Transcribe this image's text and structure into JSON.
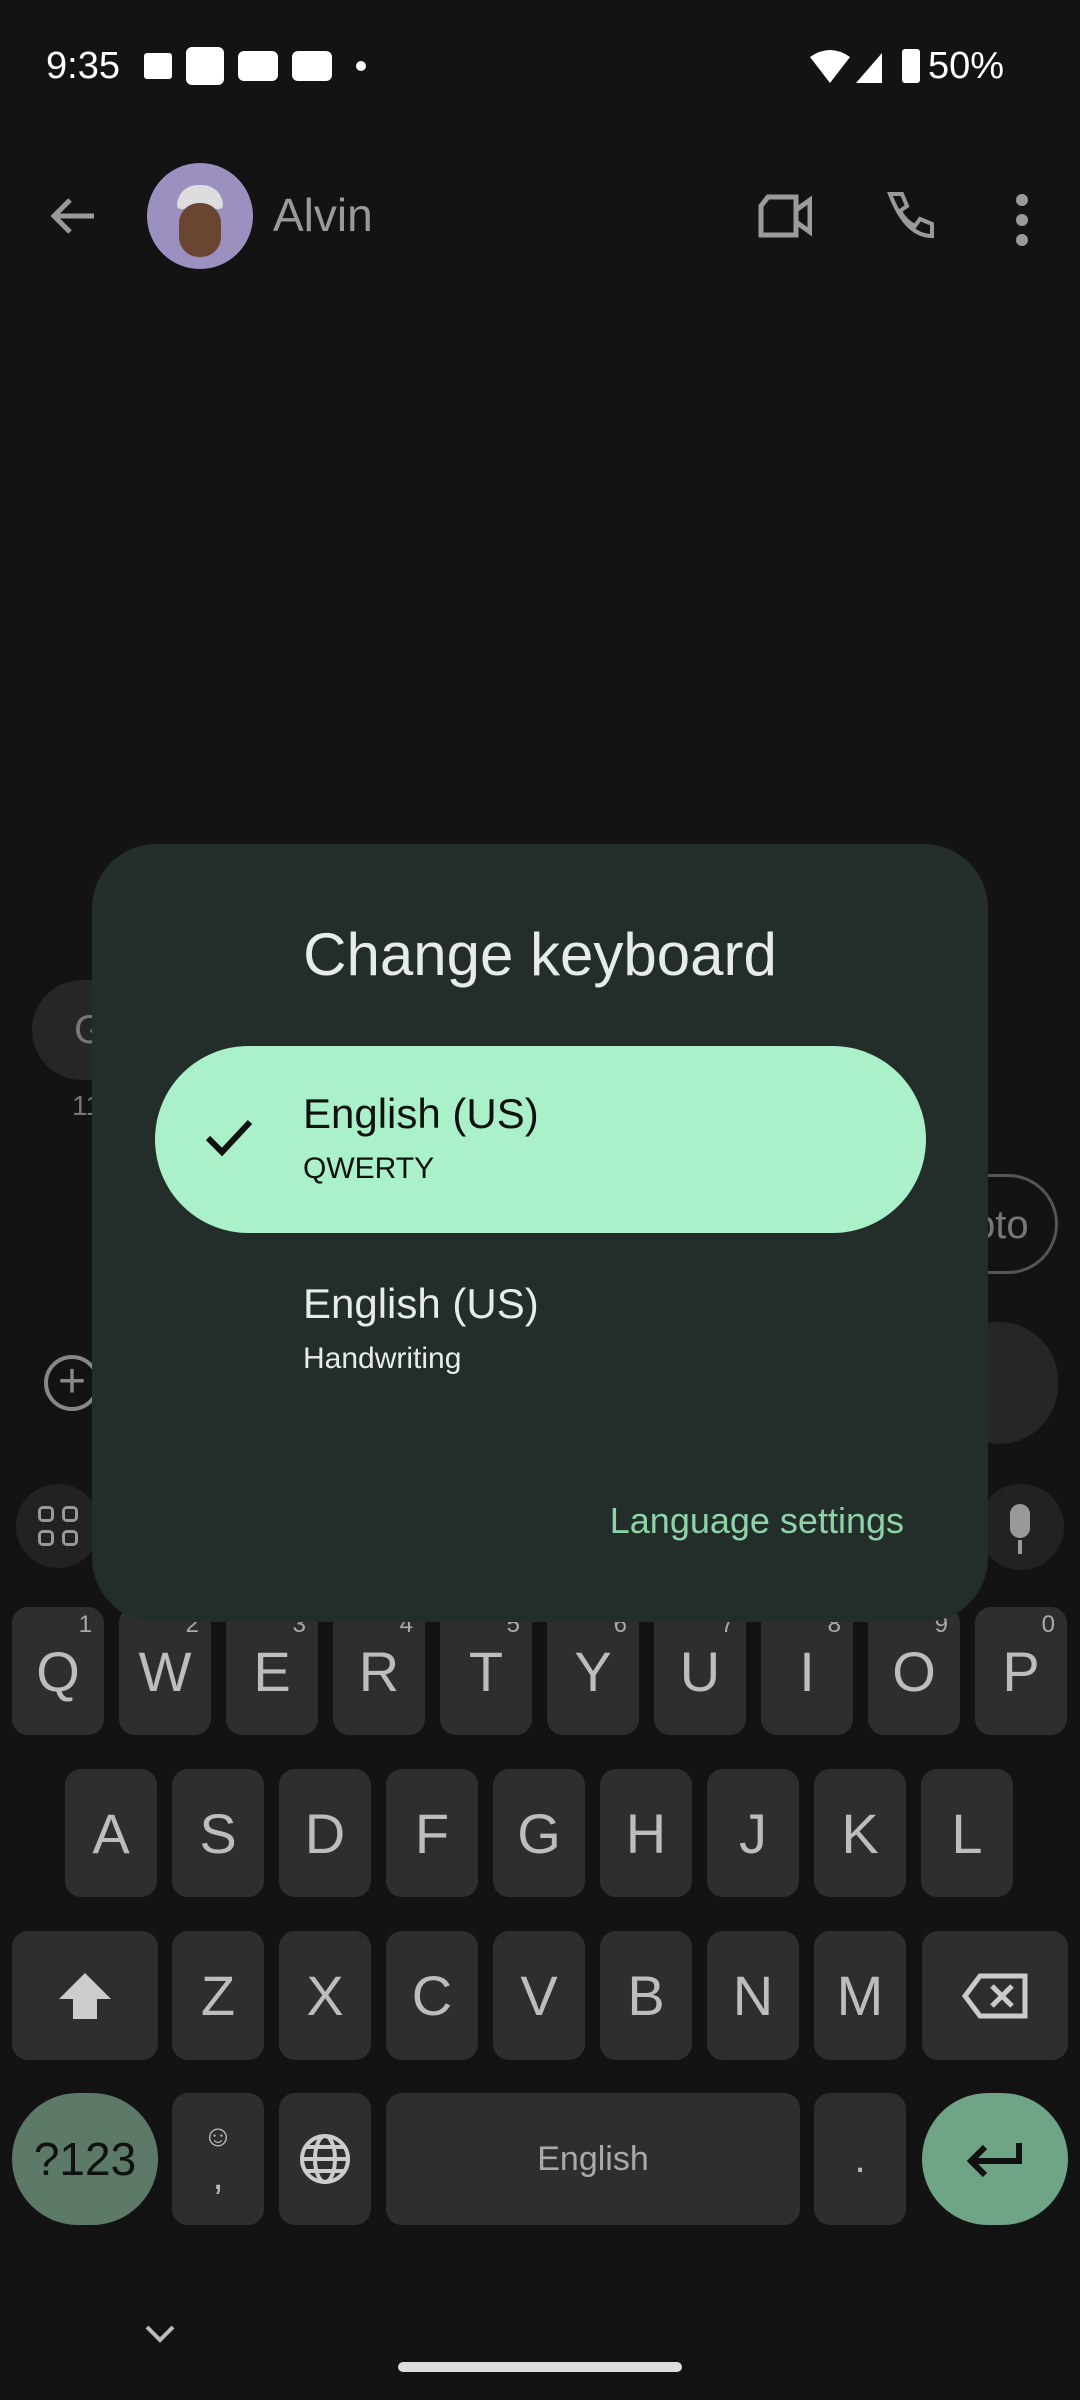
{
  "status_bar": {
    "time": "9:35",
    "battery": "50%",
    "icons": [
      "wallet-icon",
      "notes-icon",
      "youtube-icon",
      "youtube-icon",
      "dot-icon",
      "wifi-icon",
      "signal-icon",
      "battery-icon"
    ]
  },
  "header": {
    "contact_name": "Alvin",
    "icons": [
      "back-arrow-icon",
      "avatar",
      "video-call-icon",
      "phone-icon",
      "more-vert-icon"
    ]
  },
  "background": {
    "left_chip_text": "G",
    "left_chip_sub": "11",
    "right_chip_text": "oto"
  },
  "dialog": {
    "title": "Change keyboard",
    "options": [
      {
        "label": "English (US)",
        "sublabel": "QWERTY",
        "selected": true
      },
      {
        "label": "English (US)",
        "sublabel": "Handwriting",
        "selected": false
      }
    ],
    "link": "Language settings"
  },
  "keyboard": {
    "row1": [
      {
        "k": "Q",
        "n": "1"
      },
      {
        "k": "W",
        "n": "2"
      },
      {
        "k": "E",
        "n": "3"
      },
      {
        "k": "R",
        "n": "4"
      },
      {
        "k": "T",
        "n": "5"
      },
      {
        "k": "Y",
        "n": "6"
      },
      {
        "k": "U",
        "n": "7"
      },
      {
        "k": "I",
        "n": "8"
      },
      {
        "k": "O",
        "n": "9"
      },
      {
        "k": "P",
        "n": "0"
      }
    ],
    "row2": [
      "A",
      "S",
      "D",
      "F",
      "G",
      "H",
      "J",
      "K",
      "L"
    ],
    "row3": [
      "Z",
      "X",
      "C",
      "V",
      "B",
      "N",
      "M"
    ],
    "symbols_key": "?123",
    "comma_key": ",",
    "space_key": "English",
    "period_key": "."
  },
  "colors": {
    "accent": "#aaf0c8",
    "link": "#8fd4a8",
    "dialog": "#232d29",
    "enter_key": "#6fa487"
  }
}
